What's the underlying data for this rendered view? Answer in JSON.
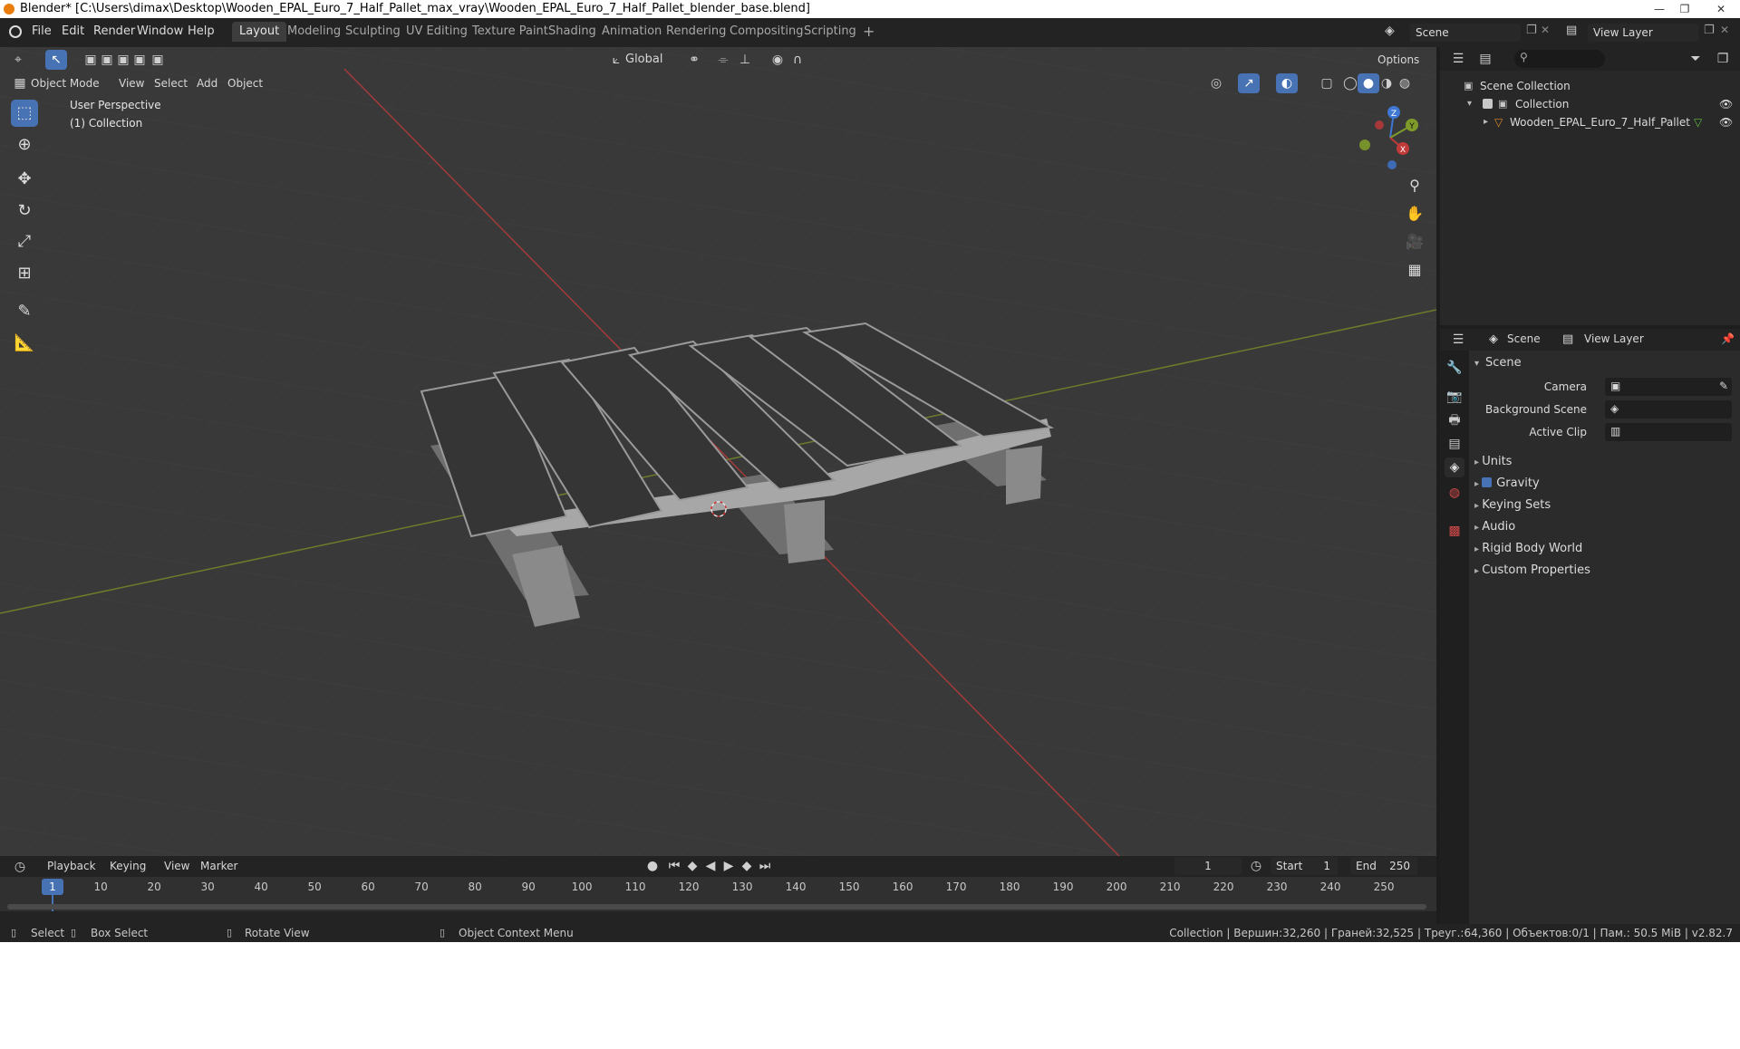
{
  "window": {
    "title": "Blender* [C:\\Users\\dimax\\Desktop\\Wooden_EPAL_Euro_7_Half_Pallet_max_vray\\Wooden_EPAL_Euro_7_Half_Pallet_blender_base.blend]",
    "min": "—",
    "max": "❐",
    "close": "✕"
  },
  "menu": [
    "File",
    "Edit",
    "Render",
    "Window",
    "Help"
  ],
  "workspaces": [
    "Layout",
    "Modeling",
    "Sculpting",
    "UV Editing",
    "Texture Paint",
    "Shading",
    "Animation",
    "Rendering",
    "Compositing",
    "Scripting"
  ],
  "add_workspace": "+",
  "scene_field": "Scene",
  "view_layer_field": "View Layer",
  "viewport": {
    "mode": "Object Mode",
    "menus": [
      "View",
      "Select",
      "Add",
      "Object"
    ],
    "orientation": "Global",
    "options": "Options",
    "overlay_line1": "User Perspective",
    "overlay_line2": "(1) Collection",
    "gizmo": {
      "x": "X",
      "y": "Y",
      "z": "Z"
    }
  },
  "outliner": {
    "root": "Scene Collection",
    "collection": "Collection",
    "object": "Wooden_EPAL_Euro_7_Half_Pallet"
  },
  "properties": {
    "tab_scene": "Scene",
    "tab_view_layer": "View Layer",
    "section": "Scene",
    "camera_label": "Camera",
    "background_label": "Background Scene",
    "clip_label": "Active Clip",
    "sections": [
      "Units",
      "Gravity",
      "Keying Sets",
      "Audio",
      "Rigid Body World",
      "Custom Properties"
    ]
  },
  "timeline": {
    "menus": [
      "Playback",
      "Keying",
      "View",
      "Marker"
    ],
    "current_frame": "1",
    "start_label": "Start",
    "start": "1",
    "end_label": "End",
    "end": "250",
    "ticks": [
      "1",
      "10",
      "20",
      "30",
      "40",
      "50",
      "60",
      "70",
      "80",
      "90",
      "100",
      "110",
      "120",
      "130",
      "140",
      "150",
      "160",
      "170",
      "180",
      "190",
      "200",
      "210",
      "220",
      "230",
      "240",
      "250"
    ]
  },
  "status": {
    "select": "Select",
    "box_select": "Box Select",
    "rotate": "Rotate View",
    "context": "Object Context Menu",
    "stats": "Collection | Вершин:32,260 | Граней:32,525 | Треуг.:64,360 | Объектов:0/1 | Пам.: 50.5 MiB | v2.82.7"
  },
  "colors": {
    "accent": "#4772b3",
    "x_axis": "#c03a3a",
    "y_axis": "#7f9c2a",
    "z_axis": "#3f77d4",
    "logo": "#e87d0d"
  }
}
